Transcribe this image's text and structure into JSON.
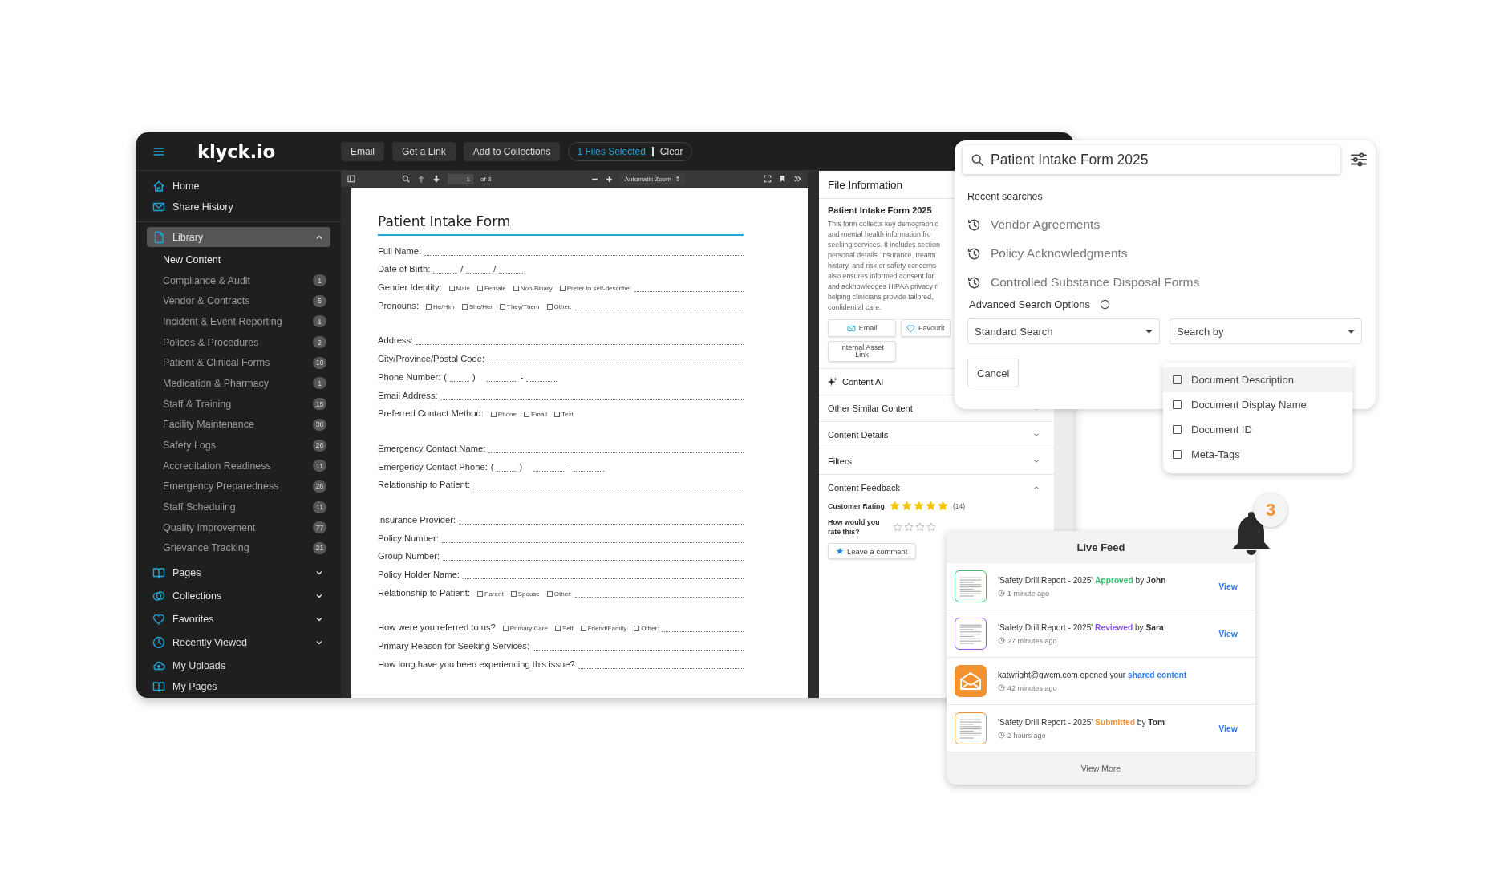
{
  "header": {
    "logo": "klyck.io",
    "buttons": [
      "Email",
      "Get a Link",
      "Add to Collections"
    ],
    "selection": {
      "count_text": "1 Files Selected",
      "clear": "Clear"
    }
  },
  "sidebar": {
    "top_links": [
      {
        "label": "Home",
        "selected": false
      },
      {
        "label": "Share History",
        "selected": false
      }
    ],
    "nav": [
      {
        "kind": "group",
        "label": "Library",
        "selected": true,
        "expanded": true,
        "children": [
          {
            "label": "New Content",
            "selected": true
          },
          {
            "label": "Compliance & Audit",
            "count": "1",
            "selected": false
          },
          {
            "label": "Vendor & Contracts",
            "count": "5",
            "selected": false
          },
          {
            "label": "Incident & Event Reporting",
            "count": "1",
            "selected": false
          },
          {
            "label": "Polices & Procedures",
            "count": "2",
            "selected": false
          },
          {
            "label": "Patient & Clinical Forms",
            "count": "10",
            "selected": false
          },
          {
            "label": "Medication & Pharmacy",
            "count": "1",
            "selected": false
          },
          {
            "label": "Staff & Training",
            "count": "15",
            "selected": false
          },
          {
            "label": "Facility Maintenance",
            "count": "38",
            "selected": false
          },
          {
            "label": "Safety Logs",
            "count": "26",
            "selected": false
          },
          {
            "label": "Accreditation Readiness",
            "count": "11",
            "selected": false
          },
          {
            "label": "Emergency Preparedness",
            "count": "26",
            "selected": false
          },
          {
            "label": "Staff Scheduling",
            "count": "11",
            "selected": false
          },
          {
            "label": "Quality Improvement",
            "count": "77",
            "selected": false
          },
          {
            "label": "Grievance Tracking",
            "count": "21",
            "selected": false
          }
        ]
      },
      {
        "kind": "group",
        "label": "Pages",
        "selected": false,
        "expanded": false
      },
      {
        "kind": "group",
        "label": "Collections",
        "selected": false,
        "expanded": false
      },
      {
        "kind": "group",
        "label": "Favorites",
        "selected": false,
        "expanded": false
      },
      {
        "kind": "group",
        "label": "Recently Viewed",
        "selected": false,
        "expanded": false
      },
      {
        "kind": "link",
        "label": "My Uploads",
        "selected": false
      },
      {
        "kind": "link",
        "label": "My Pages",
        "selected": false
      }
    ]
  },
  "viewer": {
    "page": "1",
    "page_count": "of 3",
    "zoom": "Automatic Zoom",
    "document": {
      "title": "Patient Intake Form",
      "sections": [
        {
          "rows": [
            {
              "kind": "line",
              "label": "Full Name:"
            },
            {
              "kind": "date",
              "label": "Date of Birth:",
              "marks": [
                "/",
                "/"
              ]
            },
            {
              "kind": "choice",
              "label": "Gender Identity:",
              "fill_line": true,
              "options": [
                {
                  "label": "Male",
                  "checked": false
                },
                {
                  "label": "Female",
                  "checked": false
                },
                {
                  "label": "Non-Binary",
                  "checked": false
                },
                {
                  "label": "Prefer to self-describe:",
                  "checked": false
                }
              ]
            },
            {
              "kind": "choice",
              "label": "Pronouns:",
              "fill_line": true,
              "options": [
                {
                  "label": "He/Him",
                  "checked": false
                },
                {
                  "label": "She/Her",
                  "checked": false
                },
                {
                  "label": "They/Them",
                  "checked": false
                },
                {
                  "label": "Other:",
                  "checked": false
                }
              ]
            }
          ]
        },
        {
          "rows": [
            {
              "kind": "line",
              "label": "Address:"
            },
            {
              "kind": "line",
              "label": "City/Province/Postal Code:"
            },
            {
              "kind": "phone",
              "label": "Phone Number:",
              "marks": [
                "(",
                ")",
                "-"
              ]
            },
            {
              "kind": "line",
              "label": "Email Address:"
            },
            {
              "kind": "choice",
              "label": "Preferred Contact Method:",
              "fill_line": false,
              "options": [
                {
                  "label": "Phone",
                  "checked": false
                },
                {
                  "label": "Email",
                  "checked": false
                },
                {
                  "label": "Text",
                  "checked": false
                }
              ]
            }
          ]
        },
        {
          "rows": [
            {
              "kind": "line",
              "label": "Emergency Contact Name:"
            },
            {
              "kind": "phone",
              "label": "Emergency Contact Phone:",
              "marks": [
                "(",
                ")",
                "-"
              ]
            },
            {
              "kind": "line",
              "label": "Relationship to Patient:"
            }
          ]
        },
        {
          "rows": [
            {
              "kind": "line",
              "label": "Insurance Provider:"
            },
            {
              "kind": "line",
              "label": "Policy Number:"
            },
            {
              "kind": "line",
              "label": "Group Number:"
            },
            {
              "kind": "line",
              "label": "Policy Holder Name:"
            },
            {
              "kind": "choice",
              "label": "Relationship to Patient:",
              "fill_line": true,
              "options": [
                {
                  "label": "Parent",
                  "checked": false
                },
                {
                  "label": "Spouse",
                  "checked": false
                },
                {
                  "label": "Other:",
                  "checked": false
                }
              ]
            }
          ]
        },
        {
          "rows": [
            {
              "kind": "choice",
              "label": "How were you referred to us?",
              "fill_line": true,
              "options": [
                {
                  "label": "Primary Care",
                  "checked": false
                },
                {
                  "label": "Self",
                  "checked": false
                },
                {
                  "label": "Friend/Family",
                  "checked": false
                },
                {
                  "label": "Other:",
                  "checked": false
                }
              ]
            },
            {
              "kind": "line",
              "label": "Primary Reason for Seeking Services:"
            },
            {
              "kind": "line",
              "label": "How long have you been experiencing this issue?"
            }
          ]
        }
      ]
    }
  },
  "file_info": {
    "heading": "File Information",
    "title": "Patient Intake Form 2025",
    "description_lines": [
      "This form collects key demographic",
      "and mental health information fro",
      "seeking services. It includes section",
      "personal details, insurance, treatm",
      "history, and risk or safety concerns",
      "also ensures informed consent for",
      "and acknowledges HIPAA privacy ri",
      "helping clinicians provide tailored,",
      "confidential care."
    ],
    "buttons": [
      "Email",
      "Favourit"
    ],
    "link_button": "Internal Asset Link",
    "content_ai": "Content AI",
    "sections": [
      {
        "label": "Other Similar Content",
        "expanded": false
      },
      {
        "label": "Content Details",
        "expanded": false
      },
      {
        "label": "Filters",
        "expanded": false
      },
      {
        "label": "Content Feedback",
        "expanded": true
      }
    ],
    "customer_rating": {
      "label": "Customer Rating",
      "stars": 5,
      "count": "(14)"
    },
    "rate": {
      "label": "How would you rate this?",
      "stars": 0
    },
    "comment_button": "Leave a comment"
  },
  "search": {
    "value": "Patient Intake Form 2025",
    "recent_label": "Recent searches",
    "recent": [
      "Vendor Agreements",
      "Policy Acknowledgments",
      "Controlled Substance Disposal Forms"
    ],
    "advanced_label": "Advanced Search Options",
    "mode_select": "Standard Search",
    "field_select": "Search by",
    "cancel": "Cancel",
    "options": [
      {
        "label": "Document Description",
        "checked": false,
        "selected": true
      },
      {
        "label": "Document Display Name",
        "checked": false,
        "selected": false
      },
      {
        "label": "Document ID",
        "checked": false,
        "selected": false
      },
      {
        "label": "Meta-Tags",
        "checked": false,
        "selected": false
      }
    ]
  },
  "live_feed": {
    "title": "Live Feed",
    "badge": "3",
    "items": [
      {
        "kind": "document",
        "color": "#2fc46b",
        "message": "'Safety Drill Report - 2025' **Approved** by **John**",
        "time": "1 minute ago",
        "action": "View"
      },
      {
        "kind": "document",
        "color": "#8b55f0",
        "message": "'Safety Drill Report - 2025' **Reviewed** by **Sara**",
        "time": "27 minutes ago",
        "action": "View"
      },
      {
        "kind": "email",
        "color": "#f3922f",
        "message": "katwright@gwcm.com opened your",
        "link": "shared content",
        "time": "42 minutes ago"
      },
      {
        "kind": "document",
        "color": "#f3922f",
        "message": "'Safety Drill Report - 2025' **Submitted** by **Tom**",
        "time": "2 hours ago",
        "action": "View"
      }
    ],
    "more": "View More"
  }
}
